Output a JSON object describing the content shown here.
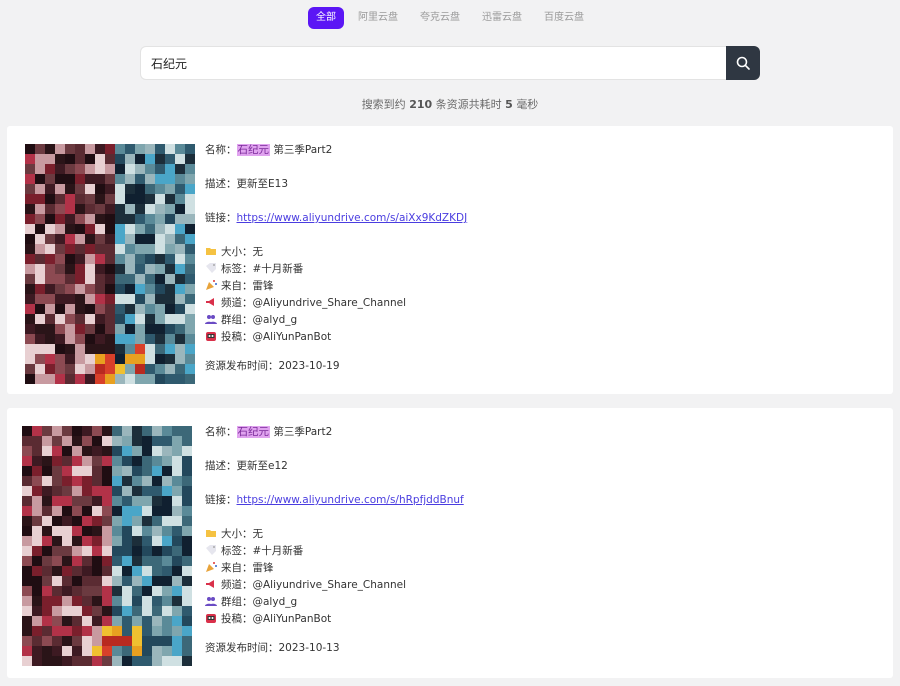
{
  "tabs": [
    {
      "label": "全部",
      "active": true
    },
    {
      "label": "阿里云盘",
      "active": false
    },
    {
      "label": "夸克云盘",
      "active": false
    },
    {
      "label": "迅雷云盘",
      "active": false
    },
    {
      "label": "百度云盘",
      "active": false
    }
  ],
  "search": {
    "value": "石纪元"
  },
  "summary": {
    "prefix": "搜索到约",
    "count": "210",
    "middle": "条资源共耗时",
    "ms": "5",
    "suffix": "毫秒"
  },
  "colors": {
    "accent": "#5b16f5",
    "highlight_bg": "#e0a3ef",
    "link": "#4a3de0"
  },
  "results": [
    {
      "name_label": "名称：",
      "name_highlight": "石纪元",
      "name_rest": " 第三季Part2",
      "desc": "描述：更新至E13",
      "link_label": "链接：",
      "link": "https://www.aliyundrive.com/s/aiXx9KdZKDJ",
      "size": "大小：无",
      "tags": "标签：#十月新番",
      "from": "来自：雷锋",
      "channel": "频道：@Aliyundrive_Share_Channel",
      "group": "群组：@alyd_g",
      "submit": "投稿：@AliYunPanBot",
      "date": "资源发布时间：2023-10-19"
    },
    {
      "name_label": "名称：",
      "name_highlight": "石纪元",
      "name_rest": " 第三季Part2",
      "desc": "描述：更新至e12",
      "link_label": "链接：",
      "link": "https://www.aliyundrive.com/s/hRpfjddBnuf",
      "size": "大小：无",
      "tags": "标签：#十月新番",
      "from": "来自：雷锋",
      "channel": "频道：@Aliyundrive_Share_Channel",
      "group": "群组：@alyd_g",
      "submit": "投稿：@AliYunPanBot",
      "date": "资源发布时间：2023-10-13"
    }
  ]
}
